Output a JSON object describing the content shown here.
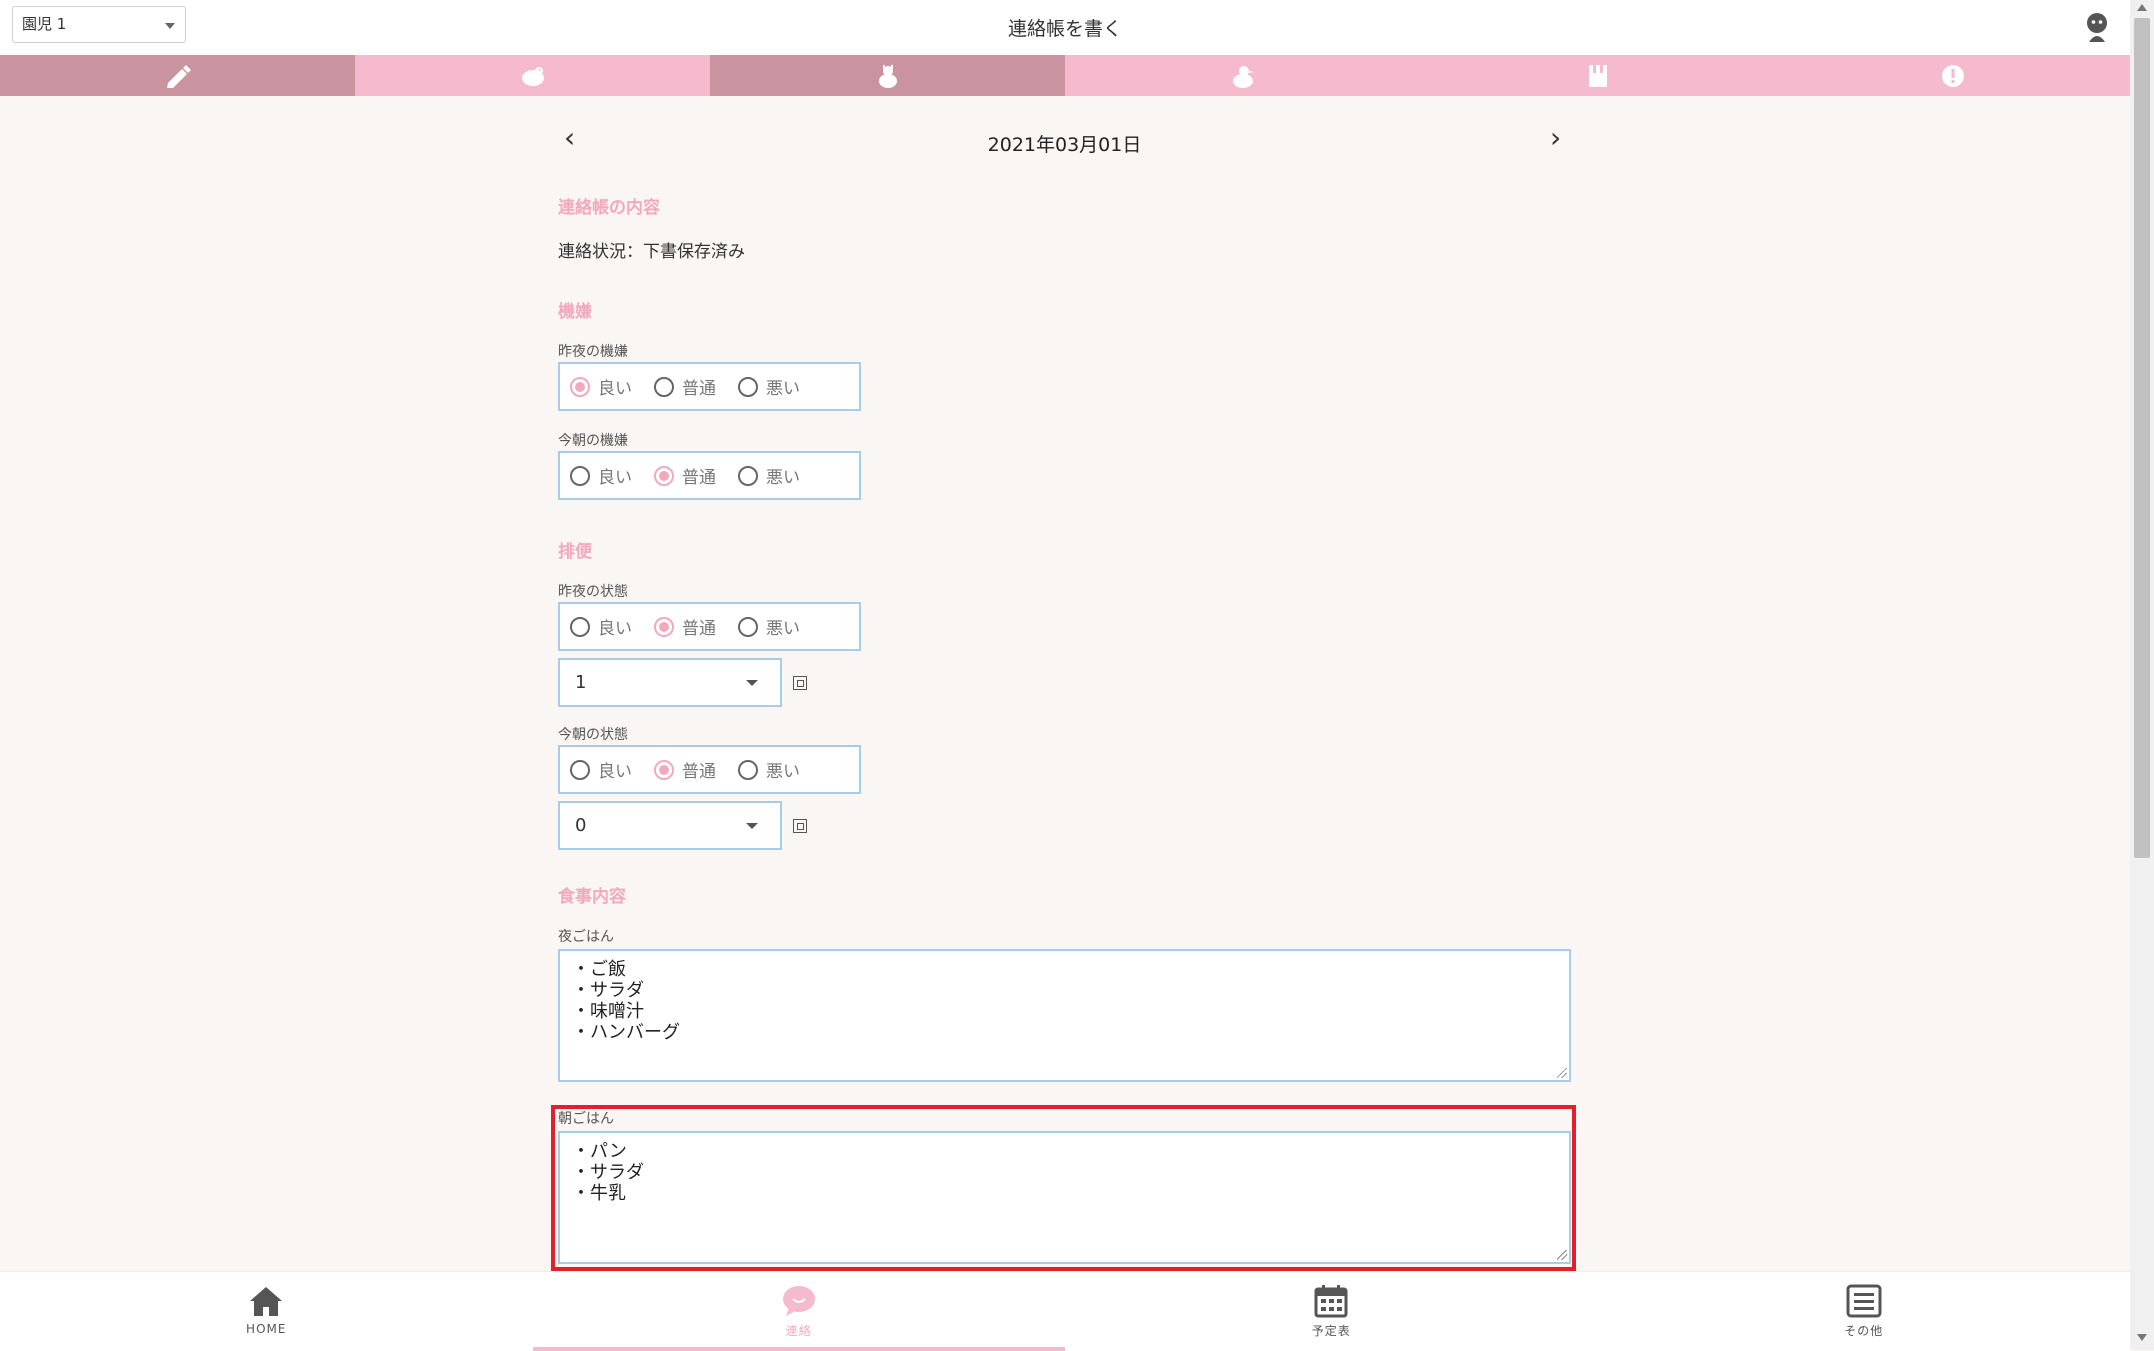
{
  "header": {
    "child_select_value": "園児 1",
    "page_title": "連絡帳を書く"
  },
  "tabs": [
    {
      "icon": "pencil-icon",
      "active": true
    },
    {
      "icon": "bird-icon",
      "active": false
    },
    {
      "icon": "chick-icon",
      "active": true
    },
    {
      "icon": "chick-2-icon",
      "active": false
    },
    {
      "icon": "note-icon",
      "active": false
    },
    {
      "icon": "alert-icon",
      "active": false
    }
  ],
  "date_nav": {
    "prev": "‹",
    "next": "›",
    "date": "2021年03月01日"
  },
  "sections": {
    "contact": {
      "title": "連絡帳の内容",
      "status": "連絡状況：下書保存済み"
    },
    "mood": {
      "title": "機嫌",
      "last_night_label": "昨夜の機嫌",
      "this_morning_label": "今朝の機嫌"
    },
    "bowel": {
      "title": "排便",
      "last_night_label": "昨夜の状態",
      "last_night_count": "1",
      "this_morning_label": "今朝の状態",
      "this_morning_count": "0"
    },
    "meals": {
      "title": "食事内容",
      "dinner_label": "夜ごはん",
      "dinner_lines": [
        "・ご飯",
        "・サラダ",
        "・味噌汁",
        "・ハンバーグ"
      ],
      "breakfast_label": "朝ごはん",
      "breakfast_lines": [
        "・パン",
        "・サラダ",
        "・牛乳"
      ]
    }
  },
  "radio_options": {
    "good": "良い",
    "normal": "普通",
    "bad": "悪い"
  },
  "radio_selected": {
    "mood_last_night": "good",
    "mood_this_morning": "normal",
    "bowel_last_night": "normal",
    "bowel_this_morning": "normal"
  },
  "bottom_nav": [
    {
      "label": "HOME",
      "icon": "home-icon",
      "active": false
    },
    {
      "label": "連絡",
      "icon": "chat-icon",
      "active": true
    },
    {
      "label": "予定表",
      "icon": "calendar-icon",
      "active": false
    },
    {
      "label": "その他",
      "icon": "menu-icon",
      "active": false
    }
  ],
  "colors": {
    "accent_pink": "#f2a9bf",
    "tab_pink": "#f5bacd",
    "tab_active": "#c9949f",
    "input_border": "#a9cde6",
    "highlight_red": "#e2202b",
    "background": "#faf6f3"
  }
}
